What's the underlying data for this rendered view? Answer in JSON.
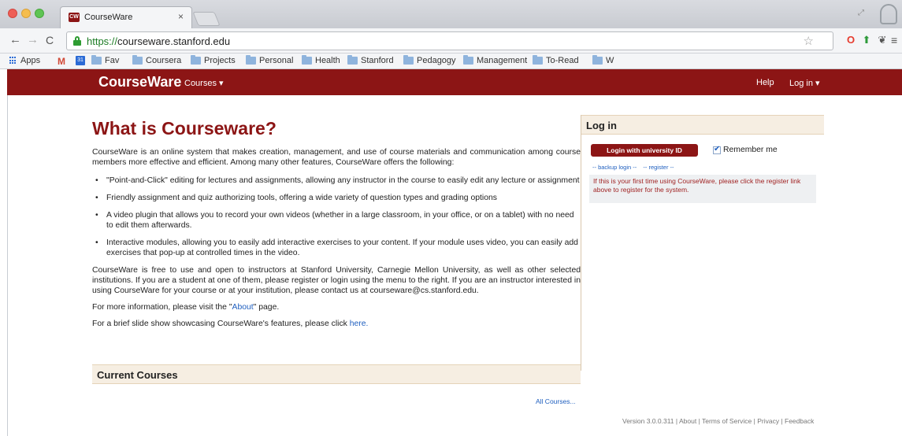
{
  "browser": {
    "tab_title": "CourseWare",
    "tab_close": "×",
    "favicon_text": "CW",
    "url_scheme": "https://",
    "url_host": "courseware.stanford.edu",
    "bookmarks": [
      "Apps",
      "Fav",
      "Coursera",
      "Projects",
      "Personal",
      "Health",
      "Stanford",
      "Pedagogy",
      "Management",
      "To-Read",
      "W"
    ]
  },
  "site_nav": {
    "brand": "CourseWare",
    "courses_menu": "Courses ▾",
    "help": "Help",
    "login_menu": "Log in ▾",
    "bar_color": "#8c1515"
  },
  "main": {
    "title": "What is Courseware?",
    "intro": "CourseWare is an online system that makes creation, management, and use of course materials and communication among course members more effective and efficient. Among many other features, CourseWare offers the following:",
    "features": [
      "\"Point-and-Click\" editing for lectures and assignments, allowing any instructor in the course to easily edit any lecture or assignment",
      "Friendly assignment and quiz authorizing tools, offering a wide variety of question types and grading options",
      "A video plugin that allows you to record your own videos (whether in a large classroom, in your office, or on a tablet) with no need to edit them afterwards.",
      "Interactive modules, allowing you to easily add interactive exercises to your content. If your module uses video, you can easily add exercises that pop-up at controlled times in the video."
    ],
    "availability": "CourseWare is free to use and open to instructors at Stanford University, Carnegie Mellon University, as well as other selected institutions. If you are a student at one of them, please register or login using the menu to the right. If you are an instructor interested in using CourseWare for your course or at your institution, please contact us at courseware@cs.stanford.edu.",
    "more_info_prefix": "For more information, please visit the \"",
    "more_info_link": "About",
    "more_info_suffix": "\" page.",
    "slideshow_prefix": "For a brief slide show showcasing CourseWare's features, please click ",
    "slideshow_link": "here.",
    "current_courses_heading": "Current Courses",
    "all_courses_link": "All Courses..."
  },
  "login": {
    "heading": "Log in",
    "university_button": "Login with university ID",
    "remember_me": "Remember me",
    "remember_checked": true,
    "backup_login": "-- backup login --",
    "register": "-- register --",
    "notice": "If this is your first time using CourseWare, please click the register link above to register for the system."
  },
  "footer": {
    "text": "Version 3.0.0.311 | About | Terms of Service | Privacy | Feedback"
  }
}
